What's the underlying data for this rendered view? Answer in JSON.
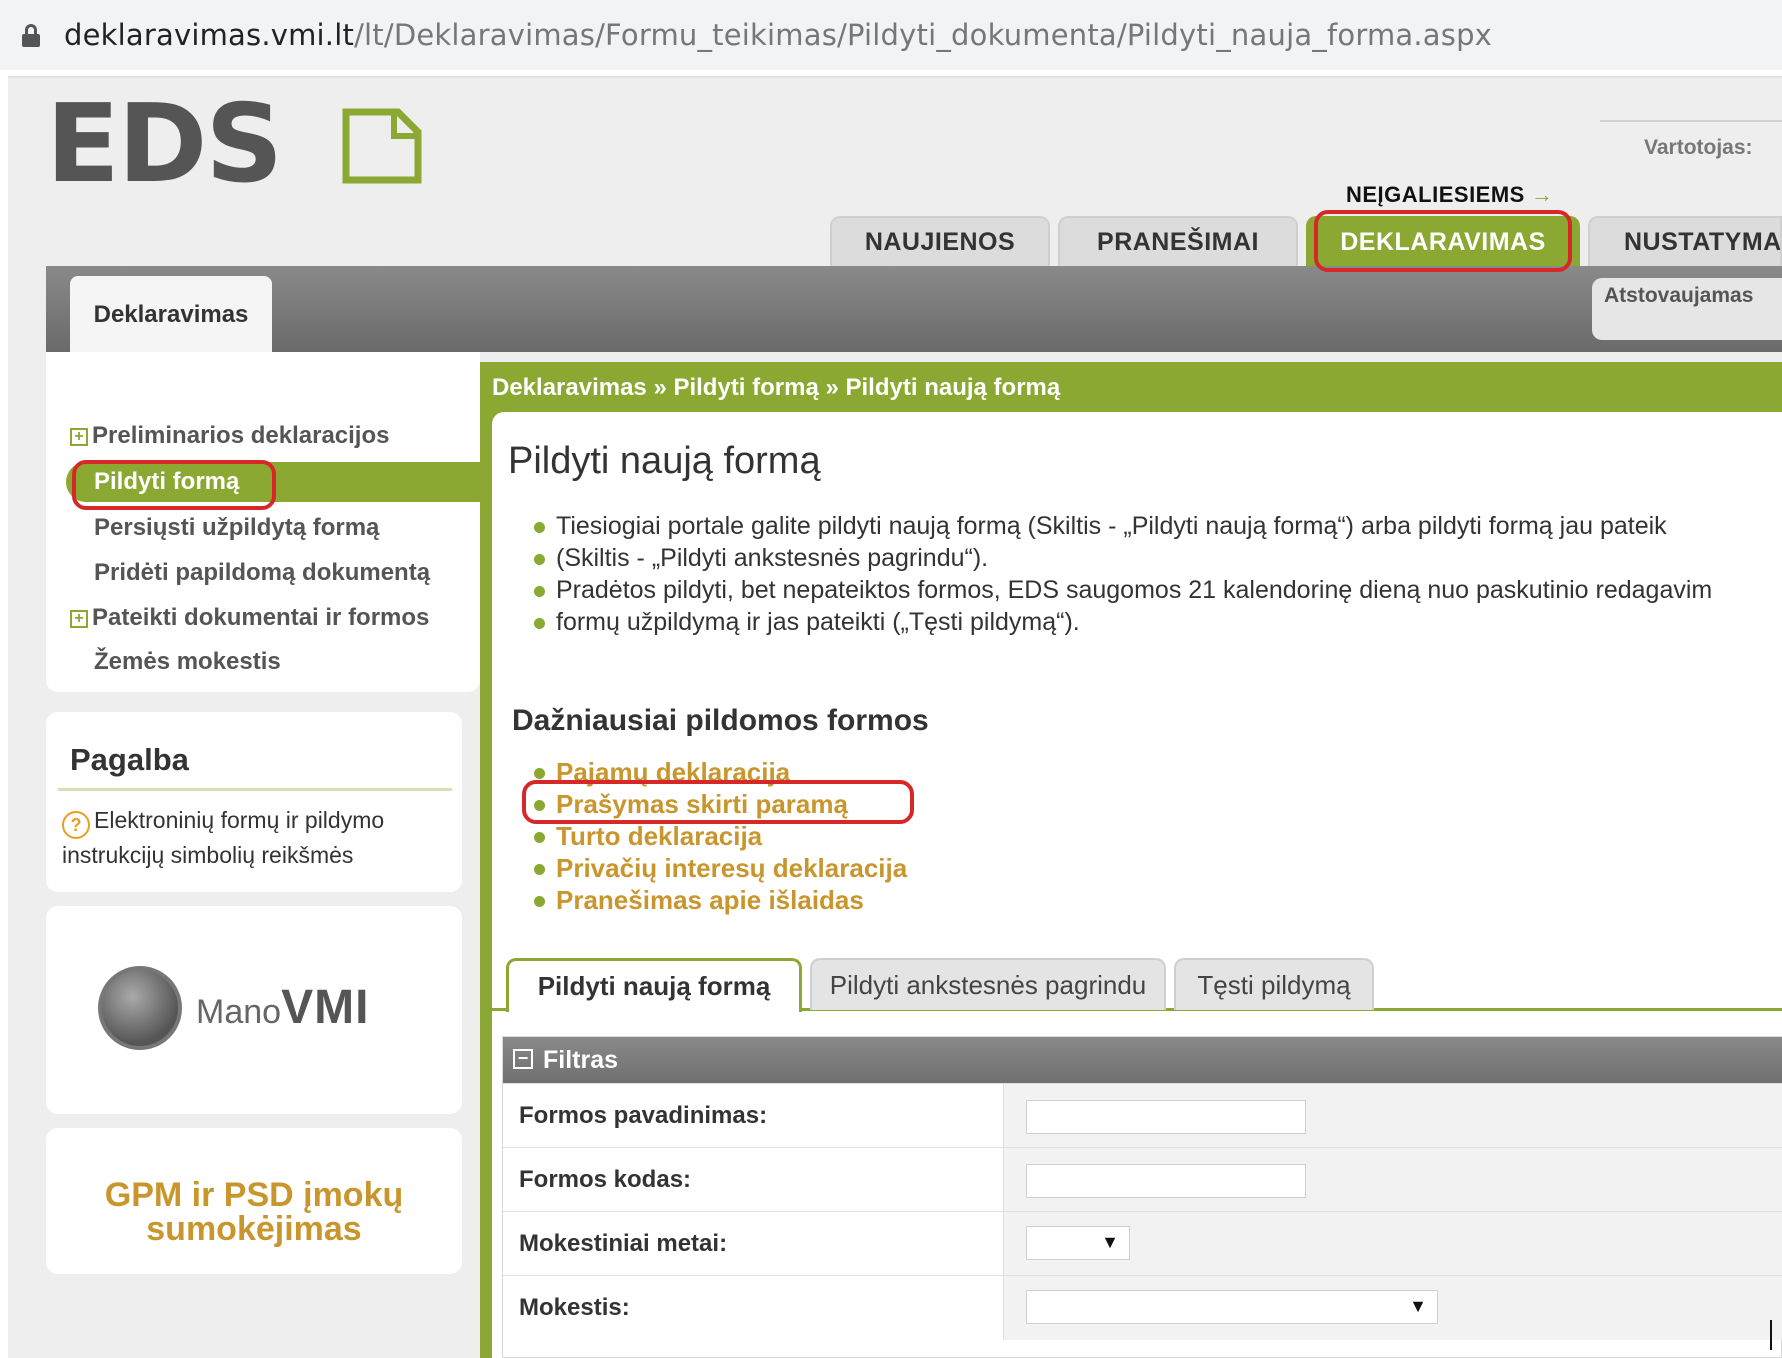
{
  "browser": {
    "url_host": "deklaravimas.vmi.lt",
    "url_path": "/lt/Deklaravimas/Formu_teikimas/Pildyti_dokumenta/Pildyti_nauja_forma.aspx"
  },
  "header": {
    "logo_text": "EDS",
    "user_label": "Vartotojas:",
    "accessibility_link": "NEĮGALIESIEMS",
    "accessibility_arrow": "→"
  },
  "top_tabs": [
    {
      "label": "NAUJIENOS",
      "active": false
    },
    {
      "label": "PRANEŠIMAI",
      "active": false
    },
    {
      "label": "DEKLARAVIMAS",
      "active": true
    },
    {
      "label": "NUSTATYMAI",
      "active": false
    }
  ],
  "sub_tab": "Deklaravimas",
  "represented_label": "Atstovaujamas",
  "left_menu": [
    {
      "label": "Preliminarios deklaracijos",
      "expandable": true,
      "active": false
    },
    {
      "label": "Pildyti formą",
      "expandable": false,
      "active": true
    },
    {
      "label": "Persiųsti užpildytą formą",
      "expandable": false,
      "active": false
    },
    {
      "label": "Pridėti papildomą dokumentą",
      "expandable": false,
      "active": false
    },
    {
      "label": "Pateikti dokumentai ir formos",
      "expandable": true,
      "active": false
    },
    {
      "label": "Žemės mokestis",
      "expandable": false,
      "active": false
    }
  ],
  "help": {
    "title": "Pagalba",
    "link": "Elektroninių formų ir pildymo instrukcijų simbolių reikšmės"
  },
  "banners": {
    "mano_vmi_small": "Mano",
    "mano_vmi_big": "VMI",
    "gpm": "GPM ir PSD įmokų sumokėjimas"
  },
  "breadcrumb": "Deklaravimas » Pildyti formą » Pildyti naują formą",
  "main": {
    "title": "Pildyti naują formą",
    "bullets": [
      "Tiesiogiai portale galite pildyti naują formą (Skiltis - „Pildyti naują formą“) arba pildyti formą jau pateik",
      "(Skiltis - „Pildyti ankstesnės pagrindu“).",
      "Pradėtos pildyti, bet nepateiktos formos, EDS saugomos 21 kalendorinę dieną nuo paskutinio redagavim",
      "formų užpildymą ir jas pateikti („Tęsti pildymą“)."
    ],
    "frequent_title": "Dažniausiai pildomos formos",
    "frequent_forms": [
      "Pajamų deklaracija",
      "Prašymas skirti paramą",
      "Turto deklaracija",
      "Privačių interesų deklaracija",
      "Pranešimas apie išlaidas"
    ],
    "tabs": [
      {
        "label": "Pildyti naują formą",
        "active": true
      },
      {
        "label": "Pildyti ankstesnės pagrindu",
        "active": false
      },
      {
        "label": "Tęsti pildymą",
        "active": false
      }
    ],
    "filter": {
      "title": "Filtras",
      "fields": [
        {
          "label": "Formos pavadinimas:",
          "value": ""
        },
        {
          "label": "Formos kodas:",
          "value": ""
        },
        {
          "label": "Mokestiniai metai:",
          "value": ""
        },
        {
          "label": "Mokestis:",
          "value": ""
        }
      ],
      "caret": "▼"
    }
  },
  "colors": {
    "accent_green": "#8aa832",
    "link_gold": "#c8962d",
    "annotation_red": "#d62828"
  }
}
